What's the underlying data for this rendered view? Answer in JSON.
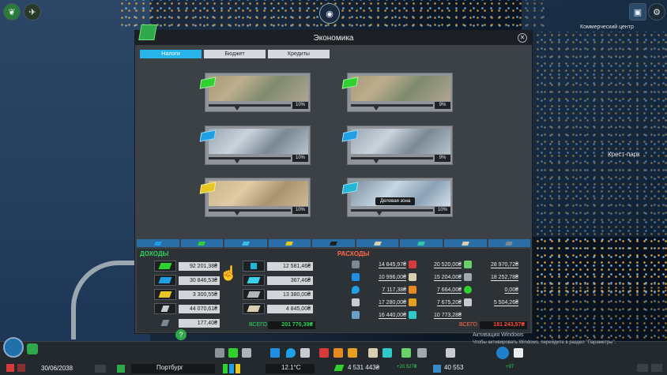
{
  "window": {
    "title": "Экономика",
    "close_icon": "close-icon",
    "tabs": [
      {
        "label": "Налоги",
        "active": true
      },
      {
        "label": "Бюджет",
        "active": false
      },
      {
        "label": "Кредиты",
        "active": false
      }
    ]
  },
  "zones": [
    {
      "id": "residential-low",
      "pct_label": "10%",
      "tax_level": 10,
      "color": "#2ed12e"
    },
    {
      "id": "residential-high",
      "pct_label": "9%",
      "tax_level": 9,
      "color": "#2ed12e"
    },
    {
      "id": "commercial-low",
      "pct_label": "10%",
      "tax_level": 10,
      "color": "#1fa0e6"
    },
    {
      "id": "commercial-high",
      "pct_label": "9%",
      "tax_level": 9,
      "color": "#1fa0e6"
    },
    {
      "id": "industrial",
      "pct_label": "10%",
      "tax_level": 10,
      "color": "#e6c61f"
    },
    {
      "id": "office",
      "pct_label": "10%",
      "tax_level": 10,
      "color": "#1fb6d8",
      "tooltip": "Деловая зона"
    }
  ],
  "income": {
    "title": "ДОХОДЫ",
    "left": [
      {
        "value": "92 201,38₴",
        "icon": "residential-icon",
        "color": "#2ed12e"
      },
      {
        "value": "30 846,53₴",
        "icon": "commercial-icon",
        "color": "#1fa0e6"
      },
      {
        "value": "3 300,55₴",
        "icon": "industrial-icon",
        "color": "#e6c61f"
      },
      {
        "value": "44 070,61₴",
        "icon": "extractor-icon",
        "color": "#c8ccd0"
      },
      {
        "value": "177,40₴",
        "icon": "transport-icon",
        "color": "#7a8894"
      }
    ],
    "right": [
      {
        "value": "12 581,46₴",
        "icon": "citizen-icon",
        "color": "#1fb6d8"
      },
      {
        "value": "367,46₴",
        "icon": "office-icon",
        "color": "#39d0e8"
      },
      {
        "value": "13 380,00₴",
        "icon": "tourism-icon",
        "color": "#b0b6ba"
      },
      {
        "value": "4 845,00₴",
        "icon": "book-icon",
        "color": "#d8d0b0"
      }
    ],
    "total_label": "ВСЕГО",
    "total": "201 770,39₴",
    "total_color": "#2fd25a"
  },
  "expenses": {
    "title": "РАСХОДЫ",
    "col1": [
      {
        "value": "14 845,97₴",
        "icon": "road-icon",
        "color": "#7a8894"
      },
      {
        "value": "10 996,00₴",
        "icon": "electricity-icon",
        "color": "#1f8fe6"
      },
      {
        "value": "7 117,38₴",
        "icon": "water-icon",
        "color": "#1fa0e6"
      },
      {
        "value": "17 280,00₴",
        "icon": "garbage-icon",
        "color": "#c8ccd0"
      },
      {
        "value": "16 440,00₴",
        "icon": "metro-icon",
        "color": "#6aa0c8"
      }
    ],
    "col2": [
      {
        "value": "20 520,00₴",
        "icon": "health-icon",
        "color": "#d83a3a"
      },
      {
        "value": "15 204,00₴",
        "icon": "education-icon",
        "color": "#d8d0b0"
      },
      {
        "value": "7 664,00₴",
        "icon": "fire-icon",
        "color": "#e68a1f"
      },
      {
        "value": "7 675,20₴",
        "icon": "police-icon",
        "color": "#e6a01f"
      },
      {
        "value": "10 773,28₴",
        "icon": "public-transport-icon",
        "color": "#2ec8c8"
      }
    ],
    "col3": [
      {
        "value": "28 970,72₴",
        "icon": "parks-icon",
        "color": "#6ad06a"
      },
      {
        "value": "18 252,78₴",
        "icon": "monument-icon",
        "color": "#a0a8b0"
      },
      {
        "value": "0,00₴",
        "icon": "unique-building-icon",
        "color": "#2ed12e"
      },
      {
        "value": "5 504,26₴",
        "icon": "policy-icon",
        "color": "#c8ccd0"
      }
    ],
    "total_label": "ВСЕГО",
    "total": "181 243,57₴",
    "total_color": "#ff4a3a"
  },
  "map_labels": {
    "commercial_center": "Коммерческий центр",
    "park": "Крест-парк"
  },
  "bottom": {
    "date": "30/06/2038",
    "city_name": "Портбург",
    "temperature": "12.1°C",
    "money": "4 531 443₴",
    "money_delta": "+20 527₴",
    "population": "40 553",
    "population_delta": "+97",
    "activation_line1": "Активация Windows",
    "activation_line2": "Чтобы активировать Windows, перейдите в раздел \"Параметры\"."
  }
}
